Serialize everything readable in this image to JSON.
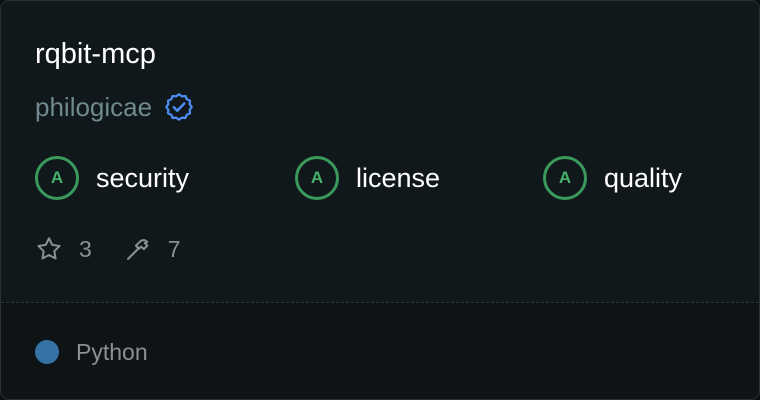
{
  "repo": {
    "name": "rqbit-mcp",
    "owner": "philogicae",
    "verified_icon": "verified-badge-icon"
  },
  "scores": [
    {
      "grade": "A",
      "label": "security"
    },
    {
      "grade": "A",
      "label": "license"
    },
    {
      "grade": "A",
      "label": "quality"
    }
  ],
  "stats": {
    "stars": "3",
    "star_icon": "star-icon",
    "tools": "7",
    "tools_icon": "hammer-icon"
  },
  "language": {
    "name": "Python",
    "color": "#3572a5"
  },
  "colors": {
    "grade_accent": "#3a9a5c",
    "verified_accent": "#4c8df6"
  }
}
